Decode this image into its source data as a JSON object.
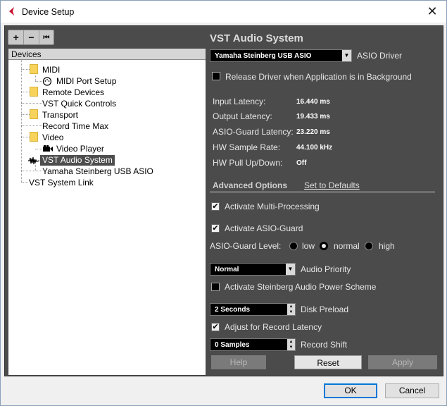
{
  "window": {
    "title": "Device Setup",
    "close_label": "✕"
  },
  "toolbar": {
    "add": "+",
    "remove": "−",
    "reset": "⏮"
  },
  "devices": {
    "header": "Devices",
    "items": [
      {
        "label": "MIDI"
      },
      {
        "label": "MIDI Port Setup"
      },
      {
        "label": "Remote Devices"
      },
      {
        "label": "VST Quick Controls"
      },
      {
        "label": "Transport"
      },
      {
        "label": "Record Time Max"
      },
      {
        "label": "Video"
      },
      {
        "label": "Video Player"
      },
      {
        "label": "VST Audio System"
      },
      {
        "label": "Yamaha Steinberg USB ASIO"
      },
      {
        "label": "VST System Link"
      }
    ]
  },
  "panel": {
    "title": "VST Audio System",
    "asio_driver": {
      "value": "Yamaha Steinberg USB ASIO",
      "label": "ASIO Driver"
    },
    "release_driver": {
      "label": "Release Driver when Application is in Background",
      "checked": false
    },
    "stats": [
      {
        "label": "Input Latency:",
        "value": "16.440 ms"
      },
      {
        "label": "Output Latency:",
        "value": "19.433 ms"
      },
      {
        "label": "ASIO-Guard Latency:",
        "value": "23.220 ms"
      },
      {
        "label": "HW Sample Rate:",
        "value": "44.100 kHz"
      },
      {
        "label": "HW Pull Up/Down:",
        "value": "Off"
      }
    ],
    "advanced_options": "Advanced Options",
    "set_to_defaults": "Set to Defaults",
    "multi_processing": {
      "label": "Activate Multi-Processing",
      "checked": true
    },
    "asio_guard": {
      "label": "Activate ASIO-Guard",
      "checked": true
    },
    "asio_guard_level": {
      "label": "ASIO-Guard Level:",
      "options": [
        "low",
        "normal",
        "high"
      ],
      "selected": "normal"
    },
    "audio_priority": {
      "value": "Normal",
      "label": "Audio Priority"
    },
    "power_scheme": {
      "label": "Activate Steinberg Audio Power Scheme",
      "checked": false
    },
    "disk_preload": {
      "value": "2 Seconds",
      "label": "Disk Preload"
    },
    "adjust_record_latency": {
      "label": "Adjust for Record Latency",
      "checked": true
    },
    "record_shift": {
      "value": "0 Samples",
      "label": "Record Shift"
    },
    "buttons": {
      "help": "Help",
      "reset": "Reset",
      "apply": "Apply"
    }
  },
  "dialog": {
    "ok": "OK",
    "cancel": "Cancel"
  }
}
